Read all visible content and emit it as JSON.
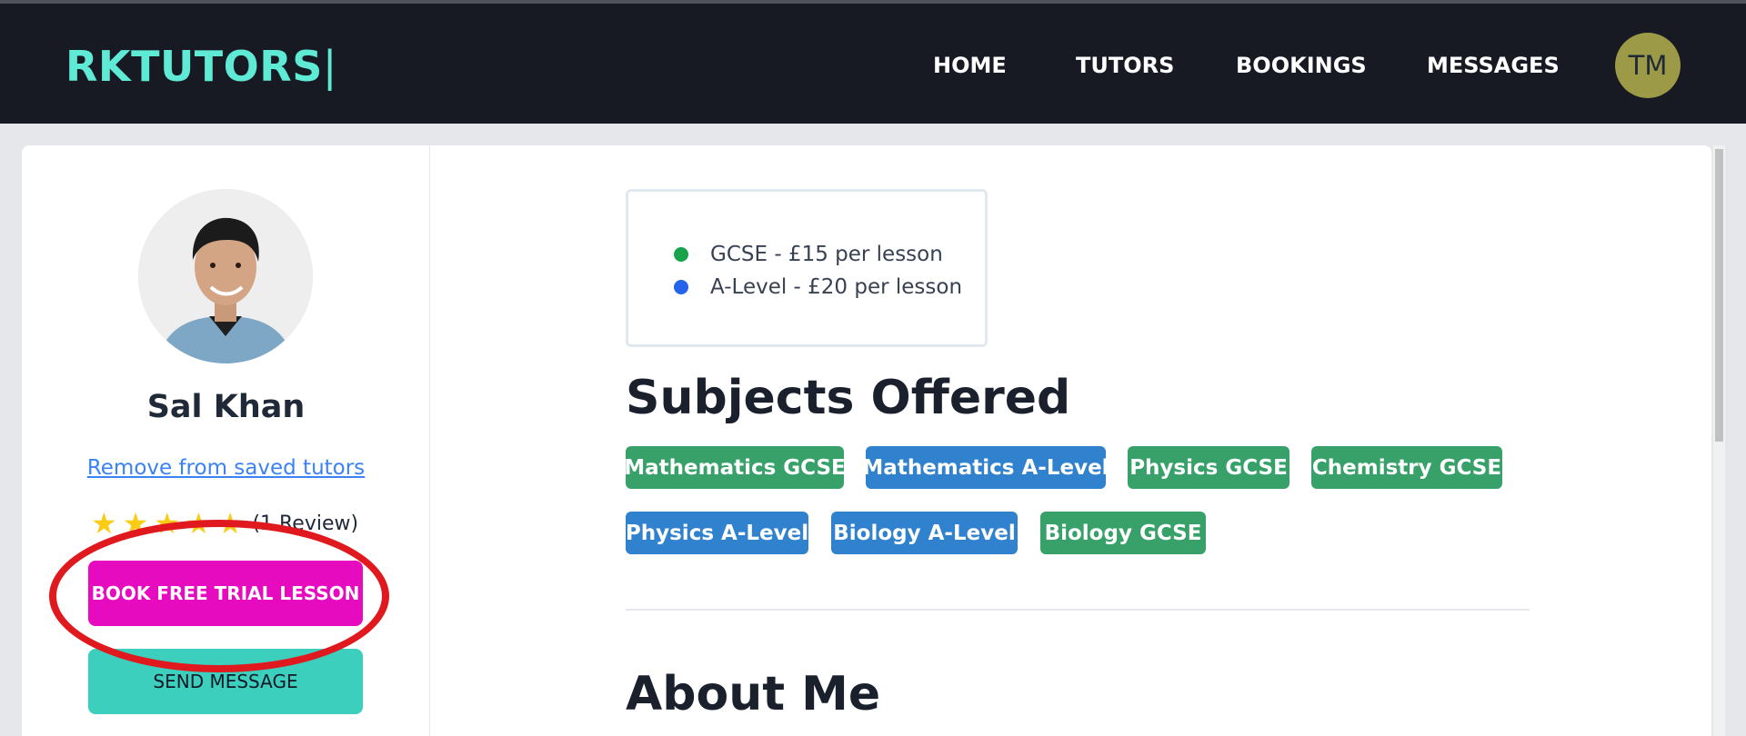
{
  "header": {
    "brand": "RKTUTORS",
    "brand_cursor": "|",
    "nav": [
      "HOME",
      "TUTORS",
      "BOOKINGS",
      "MESSAGES"
    ],
    "avatar_initials": "TM"
  },
  "profile": {
    "name": "Sal Khan",
    "remove_link": "Remove from saved tutors",
    "stars": 5,
    "review_count": "(1 Review)",
    "book_button": "BOOK FREE TRIAL LESSON",
    "message_button": "SEND MESSAGE"
  },
  "pricing": [
    {
      "label": "GCSE - £15 per lesson",
      "color": "#16a34a"
    },
    {
      "label": "A-Level - £20 per lesson",
      "color": "#2563eb"
    }
  ],
  "subjects": {
    "title": "Subjects Offered",
    "tags": [
      {
        "label": "Mathematics GCSE",
        "level": "GCSE"
      },
      {
        "label": "Mathematics A-Level",
        "level": "A-Level"
      },
      {
        "label": "Physics GCSE",
        "level": "GCSE"
      },
      {
        "label": "Chemistry GCSE",
        "level": "GCSE"
      },
      {
        "label": "Physics A-Level",
        "level": "A-Level"
      },
      {
        "label": "Biology A-Level",
        "level": "A-Level"
      },
      {
        "label": "Biology GCSE",
        "level": "GCSE"
      }
    ]
  },
  "about": {
    "title": "About Me"
  },
  "colors": {
    "brand": "#5eead4",
    "book_button": "#e60bbf",
    "message_button": "#3ccfbd",
    "gcse_tag": "#38a169",
    "alevel_tag": "#3182ce",
    "highlight": "#e0191f"
  }
}
